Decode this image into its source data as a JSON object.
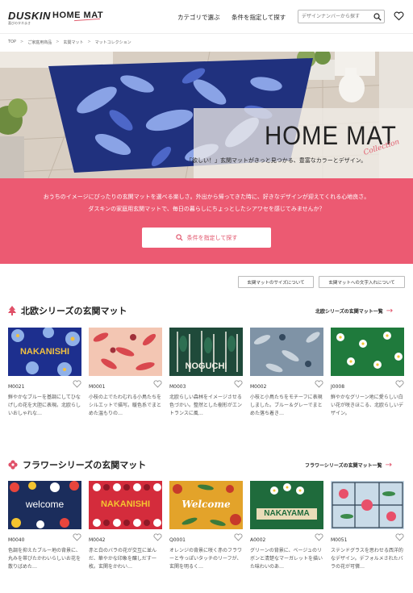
{
  "header": {
    "logo_brand": "DUSKIN",
    "logo_brand_sub": "喜びのタネまき",
    "logo_product": "HOME MAT",
    "nav_category": "カテゴリで選ぶ",
    "nav_conditions": "条件を指定して探す",
    "search_placeholder": "デザインナンバーから探す",
    "icons": {
      "search": "search-icon",
      "favorite": "heart-icon"
    }
  },
  "breadcrumb": [
    "TOP",
    "ご家庭用商品",
    "玄関マット",
    "マットコレクション"
  ],
  "hero": {
    "title": "HOME MAT",
    "script": "Collection",
    "subtitle": "「欲しい！」玄関マットがきっと見つかる、豊富なカラーとデザイン。"
  },
  "band": {
    "line1": "おうちのイメージにぴったりの玄関マットを選べる楽しさ。外出から帰ってきた時に、好きなデザインが迎えてくれる心地良さ。",
    "line2": "ダスキンの家庭用玄関マットで、毎日の暮らしにちょっとしたシアワセを感じてみませんか？",
    "button": "条件を指定して探す"
  },
  "info_buttons": [
    "玄関マットのサイズについて",
    "玄関マットへの文字入れについて"
  ],
  "sections": [
    {
      "title": "北欧シリーズの玄関マット",
      "link": "北欧シリーズの玄関マット一覧",
      "items": [
        {
          "code": "M0021",
          "desc": "鮮やかなブルーを基調にしてひなげしの花を大胆に表現。北欧らしいおしゃれな…",
          "label": "NAKANISHI"
        },
        {
          "code": "M0001",
          "desc": "小枝の上でたわむれる小鳥たちをシルエットで描写。暖色系でまとめた温もりの…",
          "label": ""
        },
        {
          "code": "M0003",
          "desc": "北欧らしい森林をイメージさせる色づかい。整然とした樹形がエントランスに風…",
          "label": "NOGUCHI"
        },
        {
          "code": "M0002",
          "desc": "小枝と小鳥たちをモチーフに表現しました。ブルー＆グレーでまとめた落ち着き…",
          "label": ""
        },
        {
          "code": "J0008",
          "desc": "鮮やかなグリーン地に愛らしい白い花が咲きほこる、北欧らしいデザイン。",
          "label": ""
        }
      ]
    },
    {
      "title": "フラワーシリーズの玄関マット",
      "link": "フラワーシリーズの玄関マット一覧",
      "items": [
        {
          "code": "M0040",
          "desc": "色調を抑えたブルー地の背景に、丸みを帯びたかわいらしいお花を散りばめた…",
          "label": "welcome"
        },
        {
          "code": "M0042",
          "desc": "赤と白のバラの花が交互に並んだ、華やかな印象を醸しだす一枚。玄関をかわい…",
          "label": "NAKANISHI"
        },
        {
          "code": "Q0001",
          "desc": "オレンジの背景に咲く赤のフラワーと今っぽいタッチのリーフが、玄関を明るく…",
          "label": "Welcome"
        },
        {
          "code": "A0002",
          "desc": "グリーンの背景に、ベージュのリボンと清楚なマーガレットを描いた味わいのあ…",
          "label": "NAKAYAMA"
        },
        {
          "code": "M0051",
          "desc": "ステンドグラスを思わせる西洋的なデザイン。デフォルメされたバラの花が可憐…",
          "label": ""
        }
      ]
    }
  ]
}
